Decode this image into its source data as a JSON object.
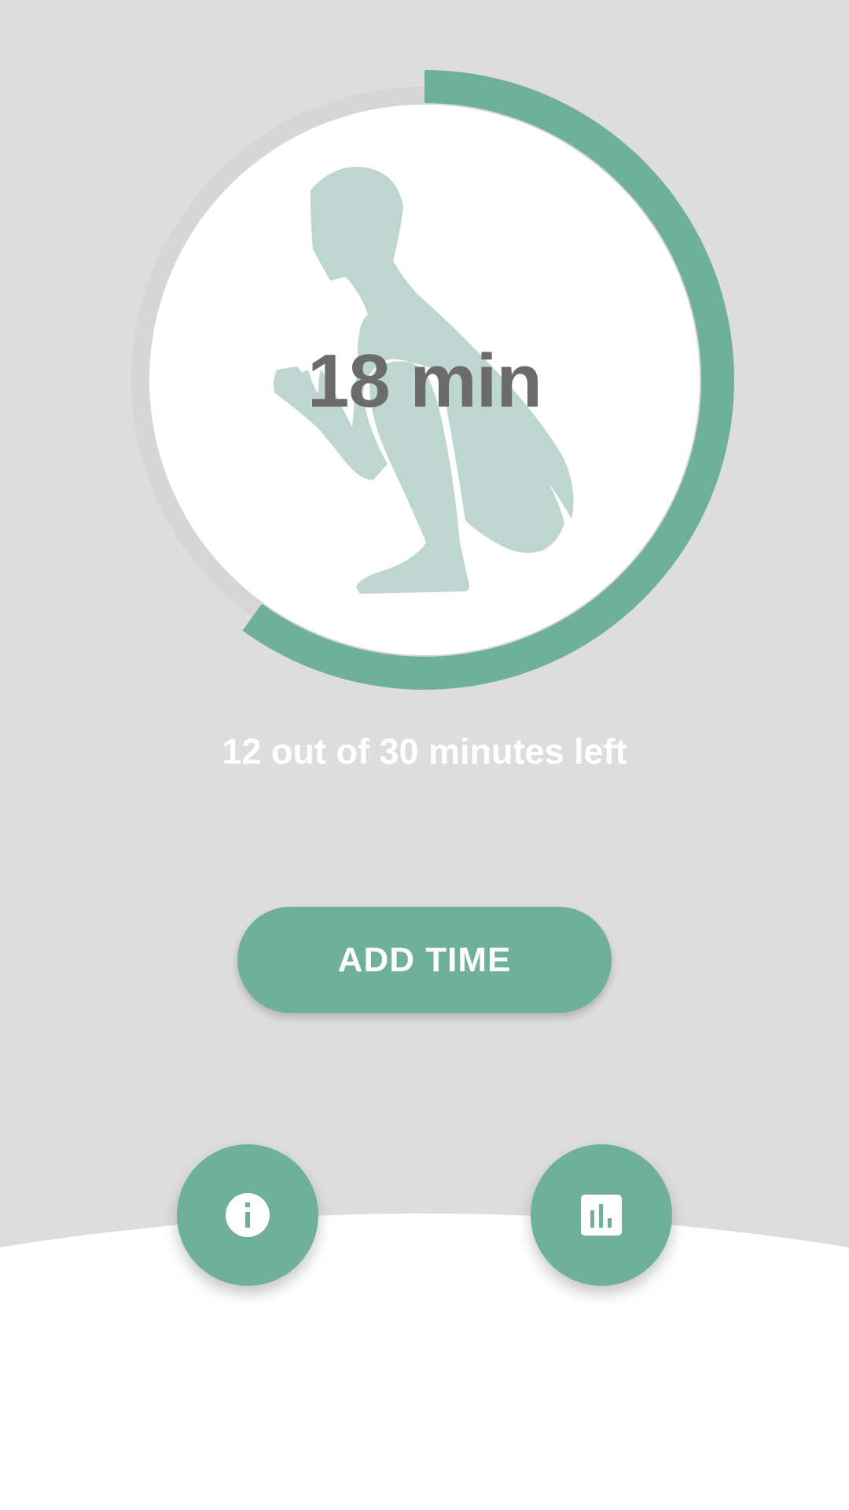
{
  "timer": {
    "time_value": "18 min",
    "remaining_text": "12 out of 30 minutes left",
    "progress_fraction": 0.6
  },
  "actions": {
    "add_time_label": "ADD TIME"
  },
  "icons": {
    "illustration": "squatting-person-illustration",
    "info": "info-icon",
    "stats": "bar-chart-icon"
  },
  "colors": {
    "background": "#dddddd",
    "accent": "#6fb09a",
    "illustration": "#bdd6cf",
    "time_text": "#6b6b6b",
    "card": "#ffffff"
  }
}
